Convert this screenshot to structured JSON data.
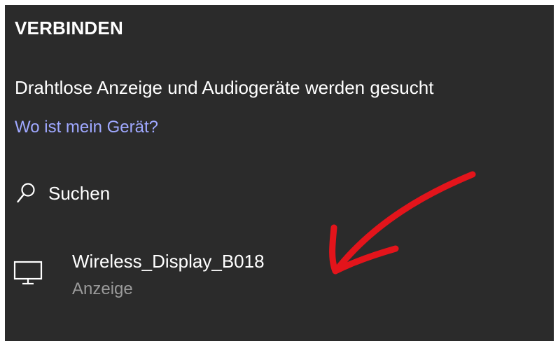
{
  "header": {
    "title": "VERBINDEN"
  },
  "status_text": "Drahtlose Anzeige und Audiogeräte werden gesucht",
  "help_link": "Wo ist mein Gerät?",
  "search": {
    "label": "Suchen",
    "icon": "search-icon"
  },
  "devices": [
    {
      "name": "Wireless_Display_B018",
      "type": "Anzeige",
      "icon": "monitor-icon"
    }
  ],
  "colors": {
    "panel_background": "#2b2b2b",
    "text": "#ffffff",
    "link": "#9fa8ff",
    "secondary_text": "#9a9a9a",
    "annotation_arrow": "#e3141b"
  },
  "annotation": {
    "type": "hand-drawn-arrow",
    "points_to": "device"
  }
}
